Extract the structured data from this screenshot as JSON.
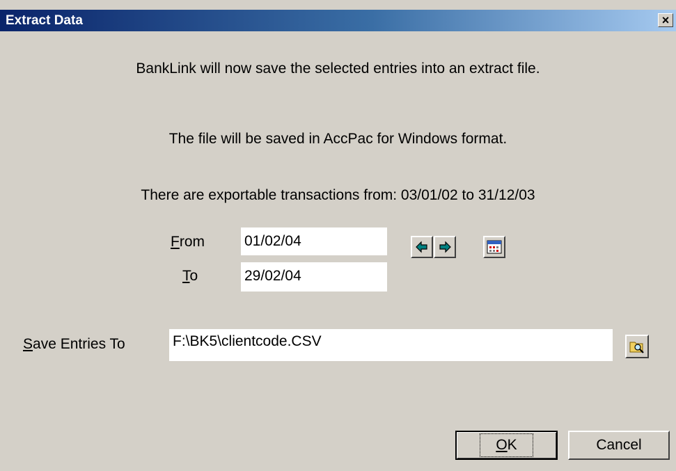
{
  "window": {
    "title": "Extract Data",
    "close_glyph": "×"
  },
  "messages": {
    "line1": "BankLink will now save the selected entries into an extract file.",
    "line2": "The file will be saved in AccPac for Windows format.",
    "line3": "There are exportable transactions from: 03/01/02 to 31/12/03"
  },
  "dates": {
    "from_label_hotkey": "F",
    "from_label_rest": "rom",
    "from_value": "01/02/04",
    "to_label_hotkey": "T",
    "to_label_rest": "o",
    "to_value": "29/02/04"
  },
  "save": {
    "label_hotkey": "S",
    "label_rest": "ave Entries To",
    "path_value": "F:\\BK5\\clientcode.CSV"
  },
  "buttons": {
    "ok_hotkey": "O",
    "ok_rest": "K",
    "cancel": "Cancel"
  },
  "colors": {
    "face": "#d4d0c8",
    "title_start": "#0a246a",
    "title_end": "#a6caf0",
    "arrow_fill": "#008080"
  },
  "icons": [
    "prev-period-arrow-icon",
    "next-period-arrow-icon",
    "calendar-icon",
    "browse-folder-icon"
  ]
}
